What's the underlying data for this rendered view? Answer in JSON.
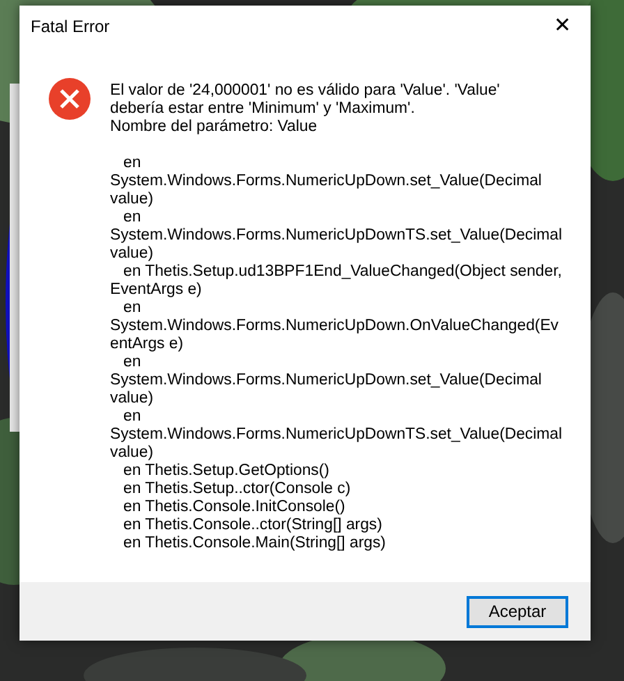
{
  "window": {
    "title": "Fatal Error",
    "close": "✕"
  },
  "message_lines": [
    "El valor de '24,000001' no es válido para 'Value'. 'Value'",
    "debería estar entre 'Minimum' y 'Maximum'.",
    "Nombre del parámetro: Value"
  ],
  "trace_lines": [
    "   en",
    "System.Windows.Forms.NumericUpDown.set_Value(Decimal",
    "value)",
    "   en",
    "System.Windows.Forms.NumericUpDownTS.set_Value(Decimal",
    "value)",
    "   en Thetis.Setup.ud13BPF1End_ValueChanged(Object sender,",
    "EventArgs e)",
    "   en",
    "System.Windows.Forms.NumericUpDown.OnValueChanged(Ev",
    "entArgs e)",
    "   en",
    "System.Windows.Forms.NumericUpDown.set_Value(Decimal",
    "value)",
    "   en",
    "System.Windows.Forms.NumericUpDownTS.set_Value(Decimal",
    "value)",
    "   en Thetis.Setup.GetOptions()",
    "   en Thetis.Setup..ctor(Console c)",
    "   en Thetis.Console.InitConsole()",
    "   en Thetis.Console..ctor(String[] args)",
    "   en Thetis.Console.Main(String[] args)"
  ],
  "buttons": [
    {
      "label": "Aceptar",
      "default": true
    }
  ]
}
